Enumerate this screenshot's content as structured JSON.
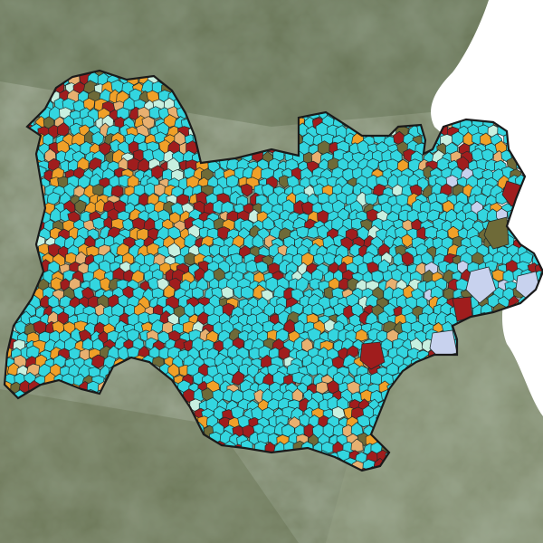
{
  "map": {
    "basemap": "satellite-imagery",
    "region_outline_color": "#1a1a1a",
    "outside_region_color": "#ffffff",
    "class_colors": [
      {
        "key": "cyan",
        "hex": "#33d6e0"
      },
      {
        "key": "dark-red",
        "hex": "#a01d1d"
      },
      {
        "key": "orange",
        "hex": "#f0a028"
      },
      {
        "key": "light-orange",
        "hex": "#e8b070"
      },
      {
        "key": "olive",
        "hex": "#6e6a38"
      },
      {
        "key": "pale-mint",
        "hex": "#c8f0e0"
      },
      {
        "key": "lavender",
        "hex": "#c8d2ee"
      }
    ]
  }
}
